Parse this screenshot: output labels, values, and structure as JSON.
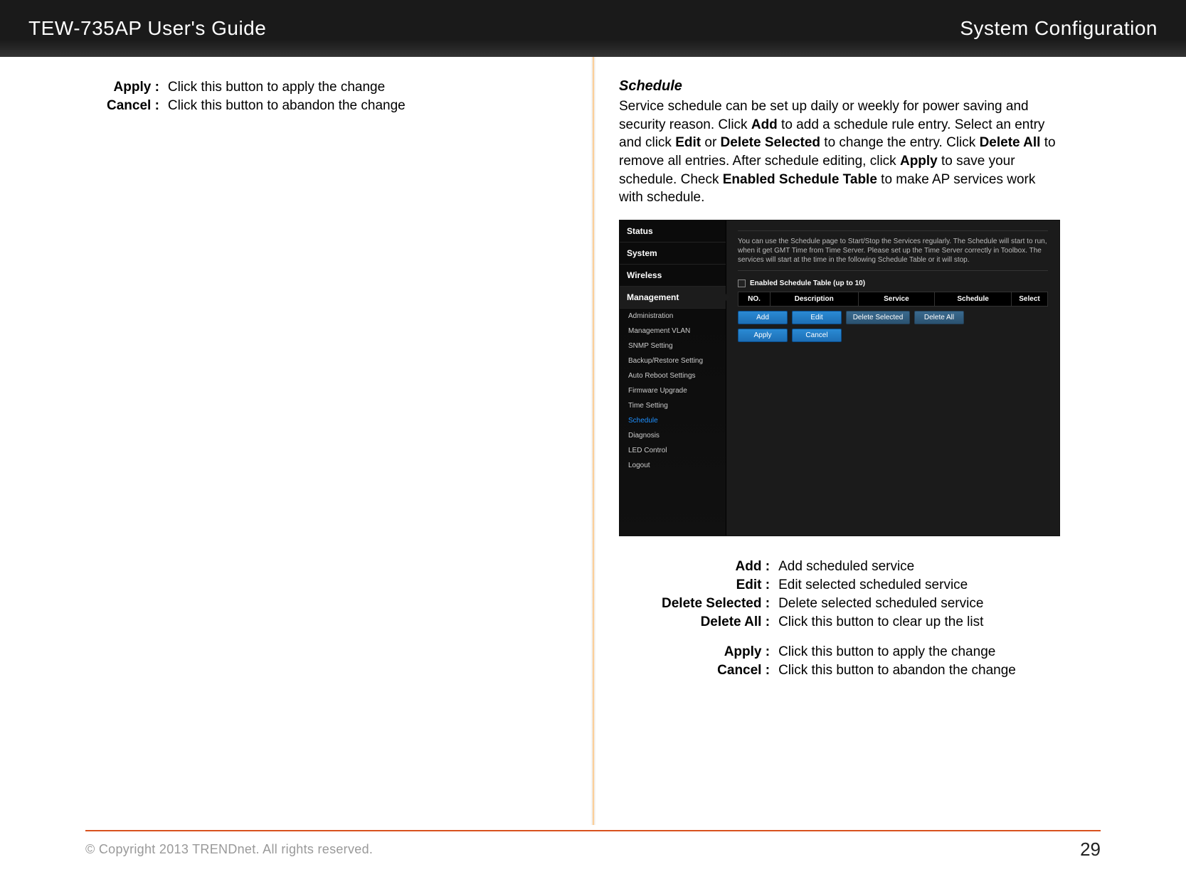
{
  "header": {
    "title": "TEW-735AP User's Guide",
    "section": "System Configuration"
  },
  "left_defs": [
    {
      "term": "Apply :",
      "desc": "Click this button to apply the change"
    },
    {
      "term": "Cancel :",
      "desc": "Click this button to abandon the change"
    }
  ],
  "schedule": {
    "heading": "Schedule",
    "body_parts": [
      "Service schedule can be set up daily or weekly for power saving and security reason. Click ",
      "Add",
      " to add a schedule rule entry. Select an entry and click ",
      "Edit",
      " or ",
      "Delete Selected",
      " to change the entry. Click ",
      "Delete All",
      " to remove all entries. After schedule editing, click ",
      "Apply",
      " to save your schedule. Check ",
      "Enabled Schedule Table",
      " to make AP services work with schedule."
    ]
  },
  "router": {
    "nav_main": [
      "Status",
      "System",
      "Wireless",
      "Management"
    ],
    "nav_sub": [
      "Administration",
      "Management VLAN",
      "SNMP Setting",
      "Backup/Restore Setting",
      "Auto Reboot Settings",
      "Firmware Upgrade",
      "Time Setting",
      "Schedule",
      "Diagnosis",
      "LED Control",
      "Logout"
    ],
    "hint": "You can use the Schedule page to Start/Stop the Services regularly. The Schedule will start to run, when it get GMT Time from Time Server. Please set up the Time Server correctly in Toolbox. The services will start at the time in the following Schedule Table or it will stop.",
    "checkbox_label": "Enabled Schedule Table (up to 10)",
    "table_headers": {
      "no": "NO.",
      "desc": "Description",
      "svc": "Service",
      "sch": "Schedule",
      "sel": "Select"
    },
    "buttons_row1": {
      "add": "Add",
      "edit": "Edit",
      "del_sel": "Delete Selected",
      "del_all": "Delete All"
    },
    "buttons_row2": {
      "apply": "Apply",
      "cancel": "Cancel"
    }
  },
  "right_defs": [
    {
      "term": "Add :",
      "desc": "Add scheduled service"
    },
    {
      "term": "Edit :",
      "desc": "Edit selected scheduled service"
    },
    {
      "term": "Delete Selected :",
      "desc": "Delete selected scheduled service"
    },
    {
      "term": "Delete All :",
      "desc": "Click this button to clear up the list"
    }
  ],
  "right_defs2": [
    {
      "term": "Apply :",
      "desc": "Click this button to apply the change"
    },
    {
      "term": "Cancel :",
      "desc": "Click this button to abandon the change"
    }
  ],
  "footer": {
    "copy": "© Copyright 2013 TRENDnet. All rights reserved.",
    "page": "29"
  }
}
